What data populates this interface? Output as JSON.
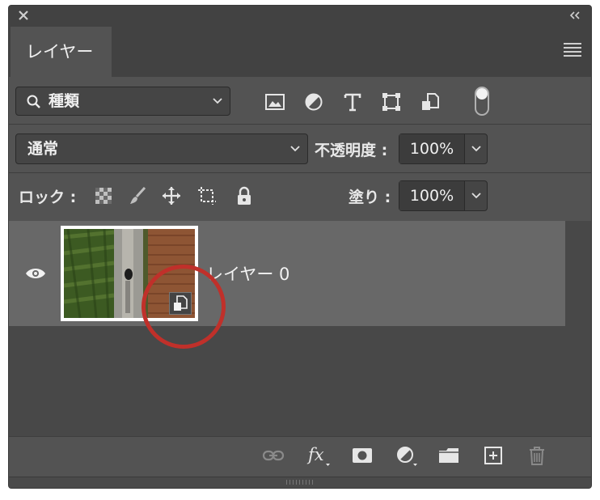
{
  "panel": {
    "tab_label": "レイヤー"
  },
  "filter": {
    "kind_label": "種類",
    "icons": [
      "image-filter-icon",
      "adjustment-filter-icon",
      "type-filter-icon",
      "shape-filter-icon",
      "smart-object-filter-icon"
    ],
    "toggle_on": true
  },
  "blend": {
    "mode_label": "通常",
    "opacity_label": "不透明度 :",
    "opacity_value": "100%"
  },
  "lock": {
    "label": "ロック :",
    "icons": [
      "lock-transparent-pixels-icon",
      "lock-image-pixels-icon",
      "lock-position-icon",
      "lock-artboard-icon",
      "lock-all-icon"
    ],
    "fill_label": "塗り :",
    "fill_value": "100%"
  },
  "layers": [
    {
      "name": "レイヤー 0",
      "visible": true,
      "smart_object": true
    }
  ],
  "footer_icons": [
    "link-layers-icon",
    "layer-style-fx-icon",
    "add-mask-icon",
    "adjustment-layer-icon",
    "new-group-folder-icon",
    "new-layer-icon",
    "delete-trash-icon"
  ],
  "colors": {
    "panel_bg": "#535353",
    "selected_row": "#686868",
    "highlight_circle": "#c0302a"
  }
}
